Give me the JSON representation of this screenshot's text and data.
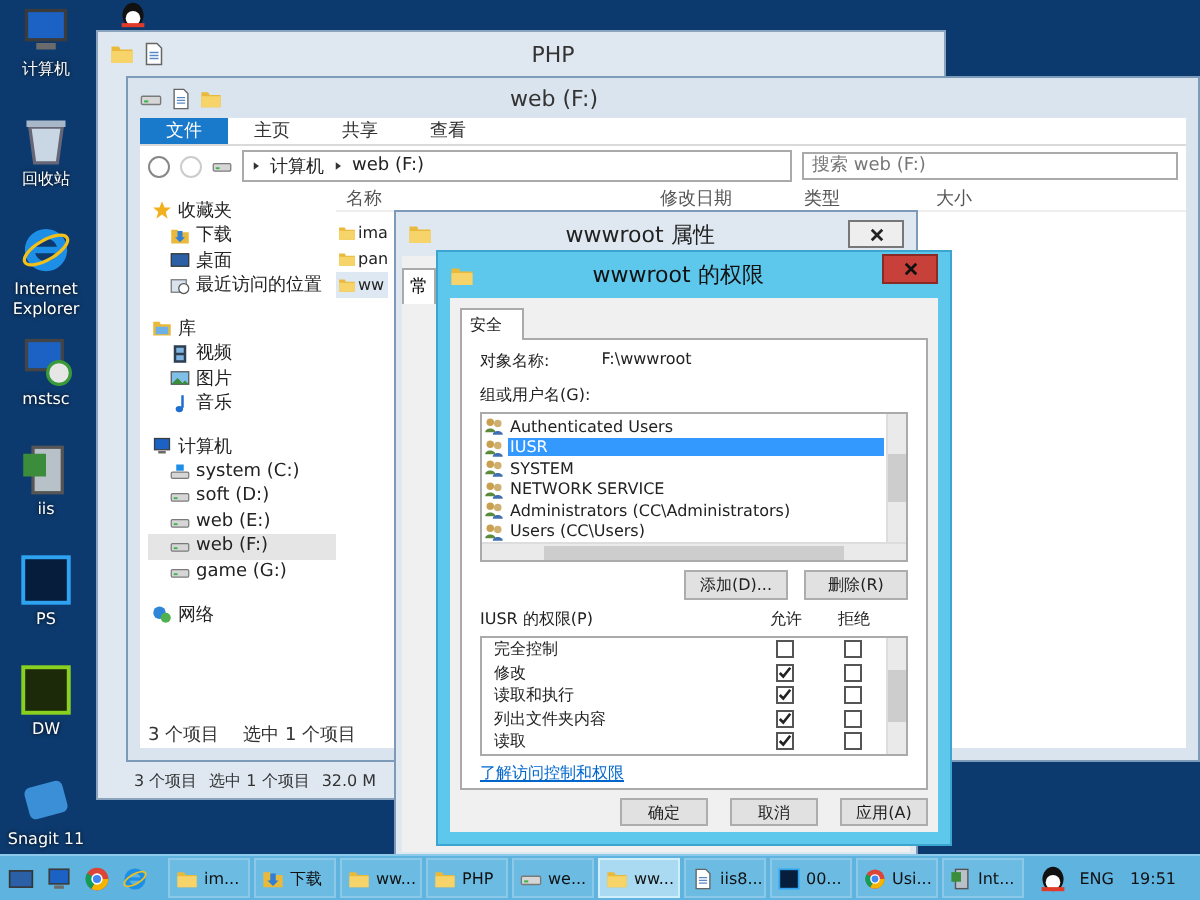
{
  "desktop_icons": [
    {
      "label": "计算机",
      "kind": "computer"
    },
    {
      "label": "回收站",
      "kind": "recycle"
    },
    {
      "label": "Internet Explorer",
      "kind": "ie"
    },
    {
      "label": "mstsc",
      "kind": "rdp"
    },
    {
      "label": "iis",
      "kind": "iis"
    },
    {
      "label": "PS",
      "kind": "ps"
    },
    {
      "label": "DW",
      "kind": "dw"
    },
    {
      "label": "Snagit 11",
      "kind": "snagit"
    }
  ],
  "back_window": {
    "title": "PHP",
    "status": [
      "3 个项目",
      "选中 1 个项目",
      "32.0 M"
    ]
  },
  "explorer": {
    "title": "web (F:)",
    "ribbon_tabs": [
      {
        "label": "文件",
        "selected": true
      },
      {
        "label": "主页",
        "selected": false
      },
      {
        "label": "共享",
        "selected": false
      },
      {
        "label": "查看",
        "selected": false
      }
    ],
    "breadcrumb": [
      "计算机",
      "web (F:)"
    ],
    "search": {
      "placeholder": "搜索 web (F:)"
    },
    "nav": [
      {
        "label": "收藏夹",
        "kind": "star",
        "selected": false,
        "children": [
          {
            "label": "下载",
            "kind": "download",
            "selected": false
          },
          {
            "label": "桌面",
            "kind": "desktop",
            "selected": false
          },
          {
            "label": "最近访问的位置",
            "kind": "recent",
            "selected": false
          }
        ]
      },
      {
        "label": "库",
        "kind": "library",
        "selected": false,
        "children": [
          {
            "label": "视频",
            "kind": "video",
            "selected": false
          },
          {
            "label": "图片",
            "kind": "picture",
            "selected": false
          },
          {
            "label": "音乐",
            "kind": "music",
            "selected": false
          }
        ]
      },
      {
        "label": "计算机",
        "kind": "computer",
        "selected": false,
        "children": [
          {
            "label": "system (C:)",
            "kind": "sysdrive",
            "selected": false
          },
          {
            "label": "soft (D:)",
            "kind": "drive",
            "selected": false
          },
          {
            "label": "web (E:)",
            "kind": "drive",
            "selected": false
          },
          {
            "label": "web (F:)",
            "kind": "drive",
            "selected": true
          },
          {
            "label": "game (G:)",
            "kind": "drive",
            "selected": false
          }
        ]
      },
      {
        "label": "网络",
        "kind": "network",
        "selected": false
      }
    ],
    "columns": [
      "名称",
      "修改日期",
      "类型",
      "大小"
    ],
    "files": [
      {
        "name": "ima",
        "selected": false
      },
      {
        "name": "pan",
        "selected": false
      },
      {
        "name": "ww",
        "selected": true
      }
    ],
    "status": [
      "3 个项目",
      "选中 1 个项目"
    ]
  },
  "properties_dialog": {
    "title": "wwwroot 属性",
    "tab": "常"
  },
  "permissions_dialog": {
    "title": "wwwroot 的权限",
    "tab": "安全",
    "object_label": "对象名称:",
    "object_value": "F:\\wwwroot",
    "group_label": "组或用户名(G):",
    "users": [
      {
        "name": "Authenticated Users",
        "selected": false
      },
      {
        "name": "IUSR",
        "selected": true
      },
      {
        "name": "SYSTEM",
        "selected": false
      },
      {
        "name": "NETWORK SERVICE",
        "selected": false
      },
      {
        "name": "Administrators (CC\\Administrators)",
        "selected": false
      },
      {
        "name": "Users (CC\\Users)",
        "selected": false
      }
    ],
    "user_buttons": [
      "添加(D)...",
      "删除(R)"
    ],
    "permissions_label": "IUSR 的权限(P)",
    "allow_label": "允许",
    "deny_label": "拒绝",
    "permissions": [
      {
        "name": "完全控制",
        "allow": false,
        "deny": false
      },
      {
        "name": "修改",
        "allow": true,
        "deny": false
      },
      {
        "name": "读取和执行",
        "allow": true,
        "deny": false
      },
      {
        "name": "列出文件夹内容",
        "allow": true,
        "deny": false
      },
      {
        "name": "读取",
        "allow": true,
        "deny": false
      }
    ],
    "link": "了解访问控制和权限",
    "buttons": [
      "确定",
      "取消",
      "应用(A)"
    ]
  },
  "taskbar": {
    "buttons": [
      {
        "label": "im...",
        "kind": "folder",
        "selected": false
      },
      {
        "label": "下载",
        "kind": "download",
        "selected": false
      },
      {
        "label": "ww...",
        "kind": "folder",
        "selected": false
      },
      {
        "label": "PHP",
        "kind": "folder",
        "selected": false
      },
      {
        "label": "we...",
        "kind": "drive",
        "selected": false
      },
      {
        "label": "ww...",
        "kind": "folder",
        "selected": true
      },
      {
        "label": "iis8...",
        "kind": "doc",
        "selected": false
      },
      {
        "label": "00...",
        "kind": "ps",
        "selected": false
      },
      {
        "label": "Usi...",
        "kind": "chrome",
        "selected": false
      },
      {
        "label": "Int...",
        "kind": "iis",
        "selected": false
      }
    ],
    "language": "ENG",
    "time": "19:51"
  }
}
